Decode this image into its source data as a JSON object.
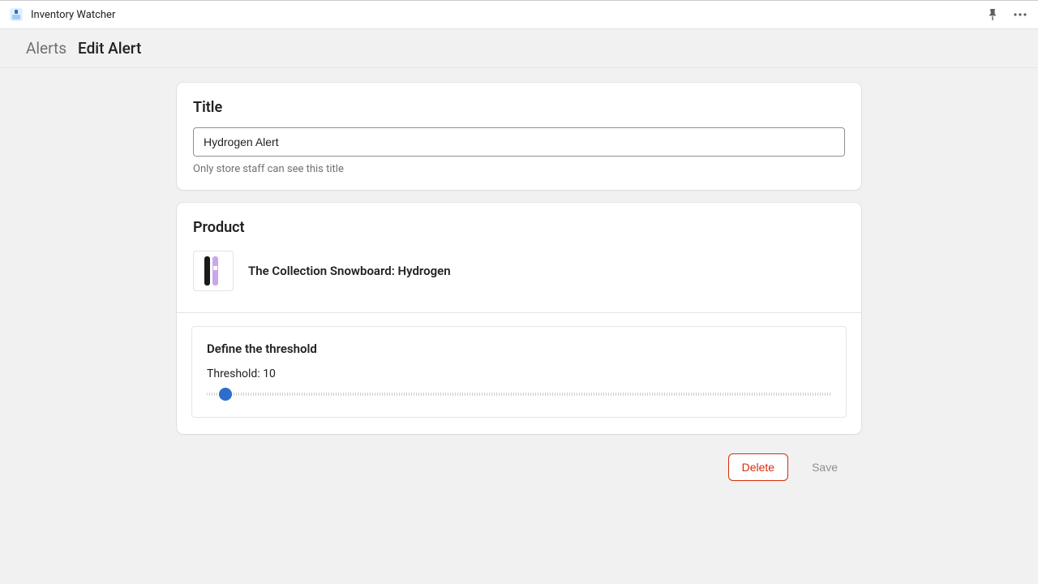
{
  "header": {
    "app_name": "Inventory Watcher"
  },
  "breadcrumb": {
    "root": "Alerts",
    "current": "Edit Alert"
  },
  "title_card": {
    "heading": "Title",
    "input_value": "Hydrogen Alert",
    "help": "Only store staff can see this title"
  },
  "product_card": {
    "heading": "Product",
    "product_name": "The Collection Snowboard: Hydrogen",
    "threshold": {
      "heading": "Define the threshold",
      "label_prefix": "Threshold: ",
      "value": 10,
      "min": 0,
      "max": 500
    }
  },
  "actions": {
    "delete": "Delete",
    "save": "Save"
  }
}
